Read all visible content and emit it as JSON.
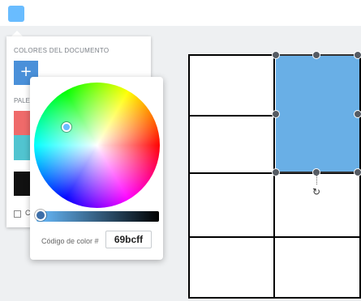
{
  "toolbar": {
    "swatch_color": "#69bcff"
  },
  "document_colors": {
    "title": "COLORES DEL DOCUMENTO",
    "add_button_label": "+",
    "add_button_color": "#4a90d9"
  },
  "palette": {
    "title": "PALE",
    "swatches": [
      "#ef6a6a",
      "#51c4d0",
      "#111111"
    ]
  },
  "checkbox_label": "C",
  "color_picker": {
    "hex_label": "Código de color #",
    "hex_value": "69bcff"
  },
  "selection": {
    "cell_color": "#69afe6",
    "rotate_icon": "rotate-icon",
    "rotate_glyph": "↻"
  }
}
